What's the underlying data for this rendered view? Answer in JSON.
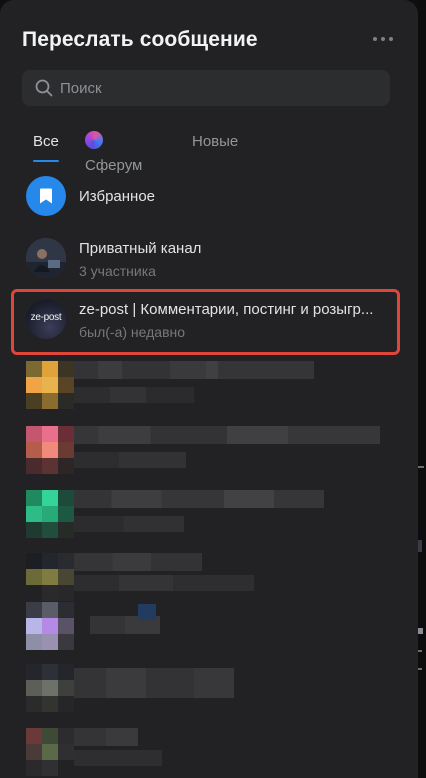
{
  "dialog": {
    "title": "Переслать сообщение",
    "more_icon": "more-horizontal-icon"
  },
  "search": {
    "placeholder": "Поиск",
    "value": "",
    "icon": "search-icon"
  },
  "tabs": [
    {
      "label": "Все",
      "active": true
    },
    {
      "label": "Сферум",
      "active": false,
      "icon": "sferum-logo-icon"
    },
    {
      "label": "Новые",
      "active": false
    }
  ],
  "contacts": [
    {
      "name": "Избранное",
      "subtitle": "",
      "avatar": "bookmark-icon"
    },
    {
      "name": "Приватный канал",
      "subtitle": "3 участника",
      "avatar": "photo-avatar"
    },
    {
      "name": "ze-post | Комментарии, постинг и розыгр...",
      "subtitle": "был(-а) недавно",
      "avatar_text": "ze-post",
      "highlighted": true
    }
  ],
  "colors": {
    "panel_bg": "#222224",
    "accent": "#2688eb",
    "highlight_border": "#e0453a",
    "text_primary": "#e1e3e6",
    "text_secondary": "#76787a"
  }
}
